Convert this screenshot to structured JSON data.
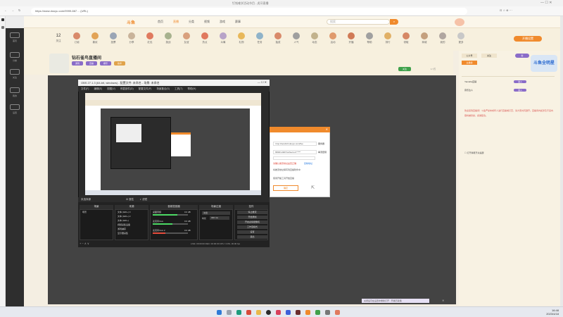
{
  "browser": {
    "tab_title": "钉钱难学活动节目 - 虎牙直播",
    "url": "https://www.douyu.com/9999-667… (URL)"
  },
  "site": {
    "logo": "斗鱼",
    "nav": [
      "首页",
      "直播",
      "分类",
      "视频",
      "游戏",
      "赛事"
    ],
    "search_placeholder": "搜索",
    "upload_btn": "上传视频"
  },
  "toolbar": {
    "items": [
      {
        "label": "12",
        "sub": "关注"
      },
      {
        "label": "订阅"
      },
      {
        "label": "喜欢"
      },
      {
        "label": "投票"
      },
      {
        "label": "分享"
      },
      {
        "label": "红包"
      },
      {
        "label": "挑战"
      },
      {
        "label": "友谊"
      },
      {
        "label": "热点"
      },
      {
        "label": "众筹"
      },
      {
        "label": "礼物"
      },
      {
        "label": "任务"
      },
      {
        "label": "抽奖"
      },
      {
        "label": "人气"
      },
      {
        "label": "动态"
      },
      {
        "label": "活动"
      },
      {
        "label": "开播"
      },
      {
        "label": "帮助"
      },
      {
        "label": "排行"
      },
      {
        "label": "领取"
      },
      {
        "label": "商城"
      },
      {
        "label": "我的"
      },
      {
        "label": "更多"
      }
    ],
    "right_btn": "开播设置"
  },
  "room": {
    "name": "钻石雀鸟直播间",
    "tags": [
      "游戏",
      "直播",
      "娱乐",
      "技术"
    ],
    "follow_btn": "关注",
    "fans": "1.7万"
  },
  "left_nav": [
    {
      "label": "首页"
    },
    {
      "label": "分类"
    },
    {
      "label": "关注"
    },
    {
      "label": "我的"
    },
    {
      "label": "设置"
    }
  ],
  "obs": {
    "title": "OBS 27.1.3 (64-bit, windows) - 配置文件: 未命名 - 场景: 未命名",
    "menus": [
      "文件(F)",
      "编辑(E)",
      "视图(V)",
      "停靠部件(D)",
      "配置文件(P)",
      "场景集合(S)",
      "工具(T)",
      "帮助(H)"
    ],
    "no_source": "未选择源",
    "props_btn": "属性",
    "filter_btn": "滤镜",
    "panels": {
      "scenes": "场景",
      "sources": "来源",
      "mixer": "音频混音器",
      "transitions": "场景过渡",
      "controls": "控件"
    },
    "scene_item": "场景",
    "sources": [
      "文本 (GDI+) 3",
      "文本 (GDI+) 2",
      "文本 (GDI+)",
      "视频采集设备",
      "游戏捕获",
      "显示器采集"
    ],
    "mixer": [
      {
        "name": "桌面音频",
        "db": "0.0 dB",
        "level": 0.7
      },
      {
        "name": "麦克风/Aux",
        "db": "0.0 dB",
        "level": 0.55
      },
      {
        "name": "麦克风/Aux 2",
        "db": "0.0 dB",
        "level": 0.35
      }
    ],
    "transition": "淡出",
    "duration_label": "时长",
    "duration": "300 ms",
    "controls": [
      "停止推流",
      "开始录制",
      "开启虚拟摄像机",
      "工作室模式",
      "设置",
      "退出"
    ],
    "status": "LIVE: 00:00:00  REC: 00:00:00  CPU: 3.0%, 30.00 fps"
  },
  "dialog": {
    "label1": "服务器",
    "value1": "rtmp://sendtc3.douyu.com/live",
    "label2": "串流密钥",
    "value2": "9999rv4kfk?wsSecret=*****",
    "warn": "请确认推流地址是否正确",
    "link": "复制地址",
    "note1": "将推流地址填写到直播软件中",
    "note2": "使用开播工具开始直播",
    "confirm": "确定"
  },
  "chat": {
    "tabs": [
      "公众号",
      "关注",
      "主播榜"
    ],
    "badge": "新",
    "rank": [
      {
        "name": "Yamaha店铺",
        "tag": "进入"
      },
      {
        "name": "音乐达人",
        "tag": "进入"
      }
    ],
    "notice": "欢迎来到直播间！斗鱼严禁未成年人进行直播或打赏，请大家共同遵守。直播间内如涉及不良内容将被封禁，感谢配合。",
    "checkbox": "打开弹幕开关提醒",
    "promo": "斗鱼全明星"
  },
  "bottom_tip": "关闭后可在设置中重新打开 · 开播已就绪",
  "taskbar": {
    "time": "16:48",
    "date": "2023/4/18",
    "icons": [
      "windows-icon",
      "search-icon",
      "edge-icon",
      "chrome-icon",
      "folder-icon",
      "obs-icon",
      "music-icon",
      "video-icon",
      "game-icon",
      "chat-icon",
      "store-icon",
      "settings-icon",
      "mail-icon"
    ]
  },
  "colors": {
    "accent": "#f08a2c",
    "obs_bg": "#2b2b2b",
    "page_bg": "#f4eee2"
  }
}
